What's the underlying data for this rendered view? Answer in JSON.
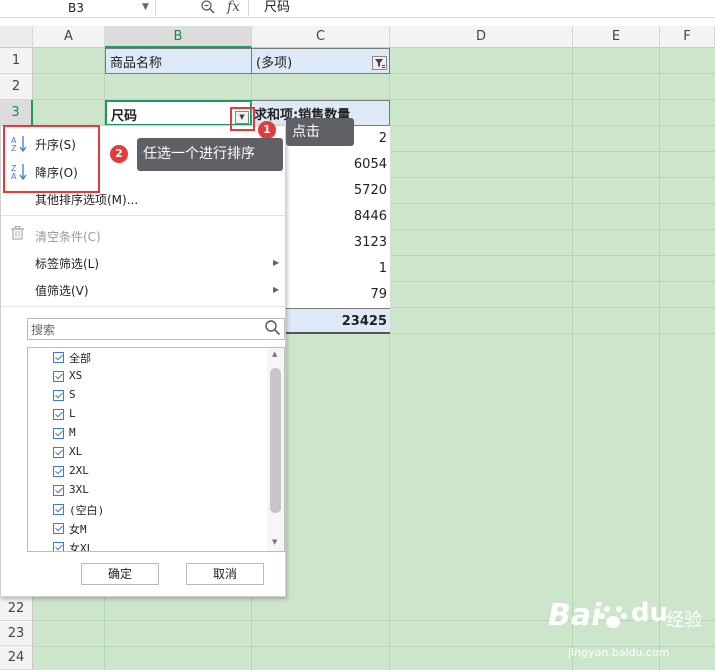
{
  "formula_bar": {
    "name_box": "B3",
    "fx_symbol": "fx",
    "content": "尺码"
  },
  "columns": [
    "A",
    "B",
    "C",
    "D",
    "E",
    "F"
  ],
  "rows": [
    "1",
    "2",
    "3",
    "22",
    "23",
    "24"
  ],
  "cells": {
    "b1": "商品名称",
    "c1": "(多项)",
    "b3": "尺码",
    "c3": "求和项:销售数量",
    "values": [
      "2",
      "6054",
      "5720",
      "8446",
      "3123",
      "1",
      "79"
    ],
    "total": "23425"
  },
  "menu": {
    "sort_asc": "升序(S)",
    "sort_desc": "降序(O)",
    "more_sort": "其他排序选项(M)...",
    "clear": "清空条件(C)",
    "label_filter": "标签筛选(L)",
    "value_filter": "值筛选(V)",
    "search_placeholder": "搜索",
    "items": [
      "全部",
      "XS",
      "S",
      "L",
      "M",
      "XL",
      "2XL",
      "3XL",
      "(空白)",
      "女M",
      "女XL"
    ],
    "ok_label": "确定",
    "cancel_label": "取消"
  },
  "annotations": {
    "step1_num": "1",
    "step1_text": "点击",
    "step2_num": "2",
    "step2_text": "任选一个进行排序"
  },
  "watermark": {
    "brand": "Bai",
    "brand2": "du",
    "cn": "经验",
    "url": "jingyan.baidu.com"
  },
  "colors": {
    "grid_bg": "#cde6cb",
    "accent_green": "#1e9a5b",
    "annotation_red": "#e23b3b",
    "checkbox_blue": "#3b7bd4"
  }
}
